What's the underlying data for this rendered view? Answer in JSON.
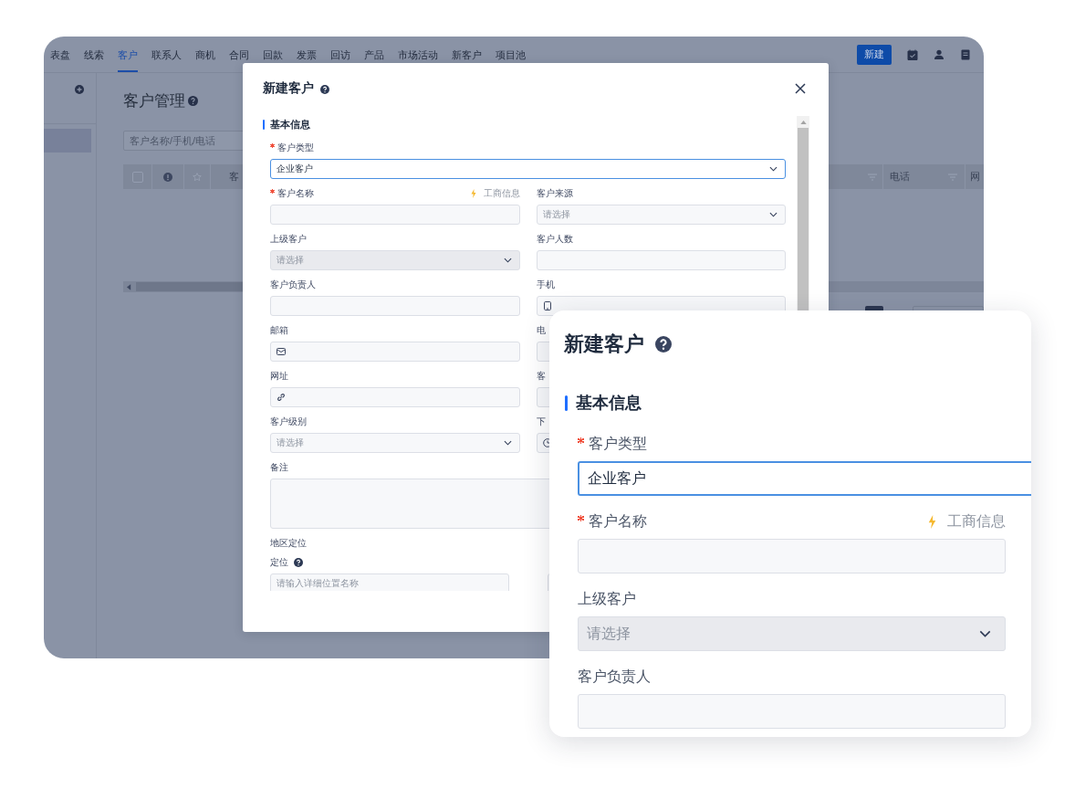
{
  "nav": {
    "tabs": [
      {
        "label": "表盘",
        "selected": false
      },
      {
        "label": "线索",
        "selected": false
      },
      {
        "label": "客户",
        "selected": true
      },
      {
        "label": "联系人",
        "selected": false
      },
      {
        "label": "商机",
        "selected": false
      },
      {
        "label": "合同",
        "selected": false
      },
      {
        "label": "回款",
        "selected": false
      },
      {
        "label": "发票",
        "selected": false
      },
      {
        "label": "回访",
        "selected": false
      },
      {
        "label": "产品",
        "selected": false
      },
      {
        "label": "市场活动",
        "selected": false
      },
      {
        "label": "新客户",
        "selected": false
      },
      {
        "label": "项目池",
        "selected": false
      }
    ],
    "new_button": "新建"
  },
  "sidebar": {
    "items": [
      {
        "selected": true
      }
    ]
  },
  "page": {
    "title": "客户管理",
    "search": {
      "placeholder": "客户名称/手机/电话"
    },
    "table": {
      "select_all": {
        "checked": false
      },
      "columns": [
        "客",
        "电话",
        "网"
      ]
    }
  },
  "dialog": {
    "title": "新建客户",
    "section": "基本信息",
    "rows": [
      {
        "kind": "single",
        "fields": [
          {
            "label": "客户类型",
            "kind": "select",
            "value": "企业客户",
            "required": true,
            "focused": true,
            "disabled": false
          }
        ]
      },
      {
        "kind": "pair",
        "fields": [
          {
            "label": "客户名称",
            "kind": "text",
            "extra": "工商信息",
            "required": true,
            "focused": false,
            "disabled": false
          },
          {
            "label": "客户来源",
            "kind": "select",
            "placeholder": "请选择",
            "required": false,
            "focused": false,
            "disabled": false
          }
        ]
      },
      {
        "kind": "pair",
        "fields": [
          {
            "label": "上级客户",
            "kind": "select",
            "placeholder": "请选择",
            "required": false,
            "focused": false,
            "disabled": true
          },
          {
            "label": "客户人数",
            "kind": "text",
            "required": false,
            "focused": false,
            "disabled": false
          }
        ]
      },
      {
        "kind": "pair",
        "fields": [
          {
            "label": "客户负责人",
            "kind": "text",
            "required": false,
            "focused": false,
            "disabled": false
          },
          {
            "label": "手机",
            "kind": "mobile",
            "required": false,
            "focused": false,
            "disabled": false
          }
        ]
      },
      {
        "kind": "pair",
        "fields": [
          {
            "label": "邮箱",
            "kind": "email",
            "required": false,
            "focused": false,
            "disabled": false
          },
          {
            "label": "电",
            "kind": "text",
            "required": false,
            "focused": false,
            "disabled": false
          }
        ]
      },
      {
        "kind": "pair",
        "fields": [
          {
            "label": "网址",
            "kind": "url",
            "required": false,
            "focused": false,
            "disabled": false
          },
          {
            "label": "客",
            "kind": "text",
            "required": false,
            "focused": false,
            "disabled": false
          }
        ]
      },
      {
        "kind": "pair",
        "fields": [
          {
            "label": "客户级别",
            "kind": "select",
            "placeholder": "请选择",
            "required": false,
            "focused": false,
            "disabled": false
          },
          {
            "label": "下",
            "kind": "date",
            "required": false,
            "focused": false,
            "disabled": false
          }
        ]
      },
      {
        "kind": "single",
        "fields": [
          {
            "label": "备注",
            "kind": "textarea",
            "required": false,
            "focused": false,
            "disabled": false
          }
        ]
      },
      {
        "kind": "heading",
        "label": "地区定位"
      },
      {
        "kind": "location",
        "fields": [
          {
            "label": "定位",
            "kind": "text",
            "placeholder": "请输入详细位置名称",
            "required": false,
            "focused": false,
            "disabled": false,
            "help": true
          },
          {
            "kind": "text",
            "focused": false,
            "disabled": false
          }
        ]
      }
    ]
  },
  "callout": {
    "title": "新建客户",
    "section": "基本信息",
    "fields": [
      {
        "label": "客户类型",
        "kind": "text",
        "value": "企业客户",
        "required": true,
        "focused": true,
        "disabled": false,
        "full_width": true
      },
      {
        "label": "客户名称",
        "kind": "text",
        "extra": "工商信息",
        "required": true,
        "focused": false,
        "disabled": false,
        "full_width": false
      },
      {
        "label": "上级客户",
        "kind": "select",
        "placeholder": "请选择",
        "required": false,
        "focused": false,
        "disabled": true,
        "full_width": false
      },
      {
        "label": "客户负责人",
        "kind": "text",
        "required": false,
        "focused": false,
        "disabled": false,
        "full_width": false
      }
    ]
  }
}
